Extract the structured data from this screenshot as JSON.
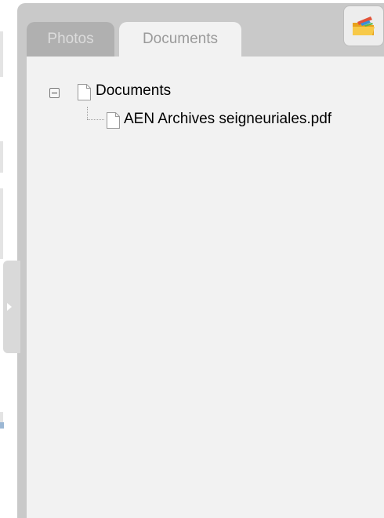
{
  "tabs": [
    {
      "label": "Photos",
      "active": false
    },
    {
      "label": "Documents",
      "active": true
    }
  ],
  "tree": {
    "root": {
      "label": "Documents",
      "expanded": true,
      "icon": "file-icon"
    },
    "children": [
      {
        "label": "AEN Archives seigneuriales.pdf",
        "icon": "file-icon"
      }
    ]
  },
  "toolbar": {
    "icon": "folder-pencil-icon"
  },
  "handle": {
    "icon": "chevron-right-icon"
  },
  "colors": {
    "panel_frame": "#c9c9c9",
    "content_bg": "#f2f2f2",
    "inactive_tab": "#b0b0b0",
    "active_tab": "#f2f2f2"
  }
}
